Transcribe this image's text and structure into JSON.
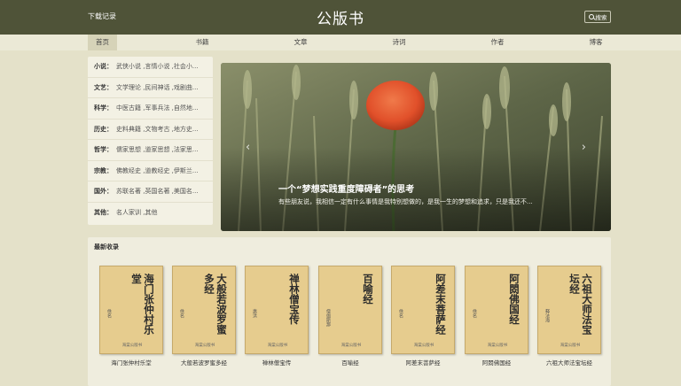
{
  "header": {
    "download_link": "下载记录",
    "site_title": "公版书",
    "search_label": "搜索"
  },
  "nav": {
    "items": [
      "首页",
      "书籍",
      "文章",
      "诗词",
      "作者",
      "博客"
    ],
    "active_index": 0
  },
  "categories": [
    {
      "label": "小说：",
      "items": "武侠小说 ,言情小说 ,社会小..."
    },
    {
      "label": "文艺：",
      "items": "文学理论 ,民间神话 ,戏剧曲..."
    },
    {
      "label": "科学：",
      "items": "中医古籍 ,军事兵法 ,自然地..."
    },
    {
      "label": "历史：",
      "items": "史料典籍 ,文物考古 ,地方史..."
    },
    {
      "label": "哲学：",
      "items": "儒家思想 ,道家思想 ,法家思..."
    },
    {
      "label": "宗教：",
      "items": "佛教经史 ,道教经史 ,伊斯兰..."
    },
    {
      "label": "国外：",
      "items": "苏联名著 ,英国名著 ,美国名..."
    },
    {
      "label": "其他：",
      "items": "名人家训 ,其他"
    }
  ],
  "banner": {
    "title": "一个“梦想实践重度障碍者”的思考",
    "description": "有些朋友说，我相信一定有什么事情是我特别想做的，是我一生的梦想和追求，只是我还不...",
    "prev_icon": "chevron-left-icon",
    "next_icon": "chevron-right-icon"
  },
  "recent": {
    "title": "最新收录",
    "books": [
      {
        "cover_title": "海门张仲村乐堂",
        "author": "佚名",
        "publisher": "海棠公版书",
        "caption": "海门张仲村乐堂"
      },
      {
        "cover_title": "大般若波罗蜜多经",
        "author": "佚名",
        "publisher": "海棠公版书",
        "caption": "大般若波罗蜜多经"
      },
      {
        "cover_title": "禅林僧宝传",
        "author": "惠洪",
        "publisher": "海棠公版书",
        "caption": "禅林僧宝传"
      },
      {
        "cover_title": "百喻经",
        "author": "僧伽斯那",
        "publisher": "海棠公版书",
        "caption": "百喻经"
      },
      {
        "cover_title": "阿差末菩萨经",
        "author": "佚名",
        "publisher": "海棠公版书",
        "caption": "阿差末菩萨经"
      },
      {
        "cover_title": "阿閦佛国经",
        "author": "佚名",
        "publisher": "海棠公版书",
        "caption": "阿閦佛国经"
      },
      {
        "cover_title": "六祖大师法宝坛经",
        "author": "释法海",
        "publisher": "海棠公版书",
        "caption": "六祖大师法宝坛经"
      }
    ]
  },
  "colors": {
    "header_bg": "#4f5338",
    "page_bg": "#e4e1c9",
    "book_cover": "#e6cc8e"
  }
}
